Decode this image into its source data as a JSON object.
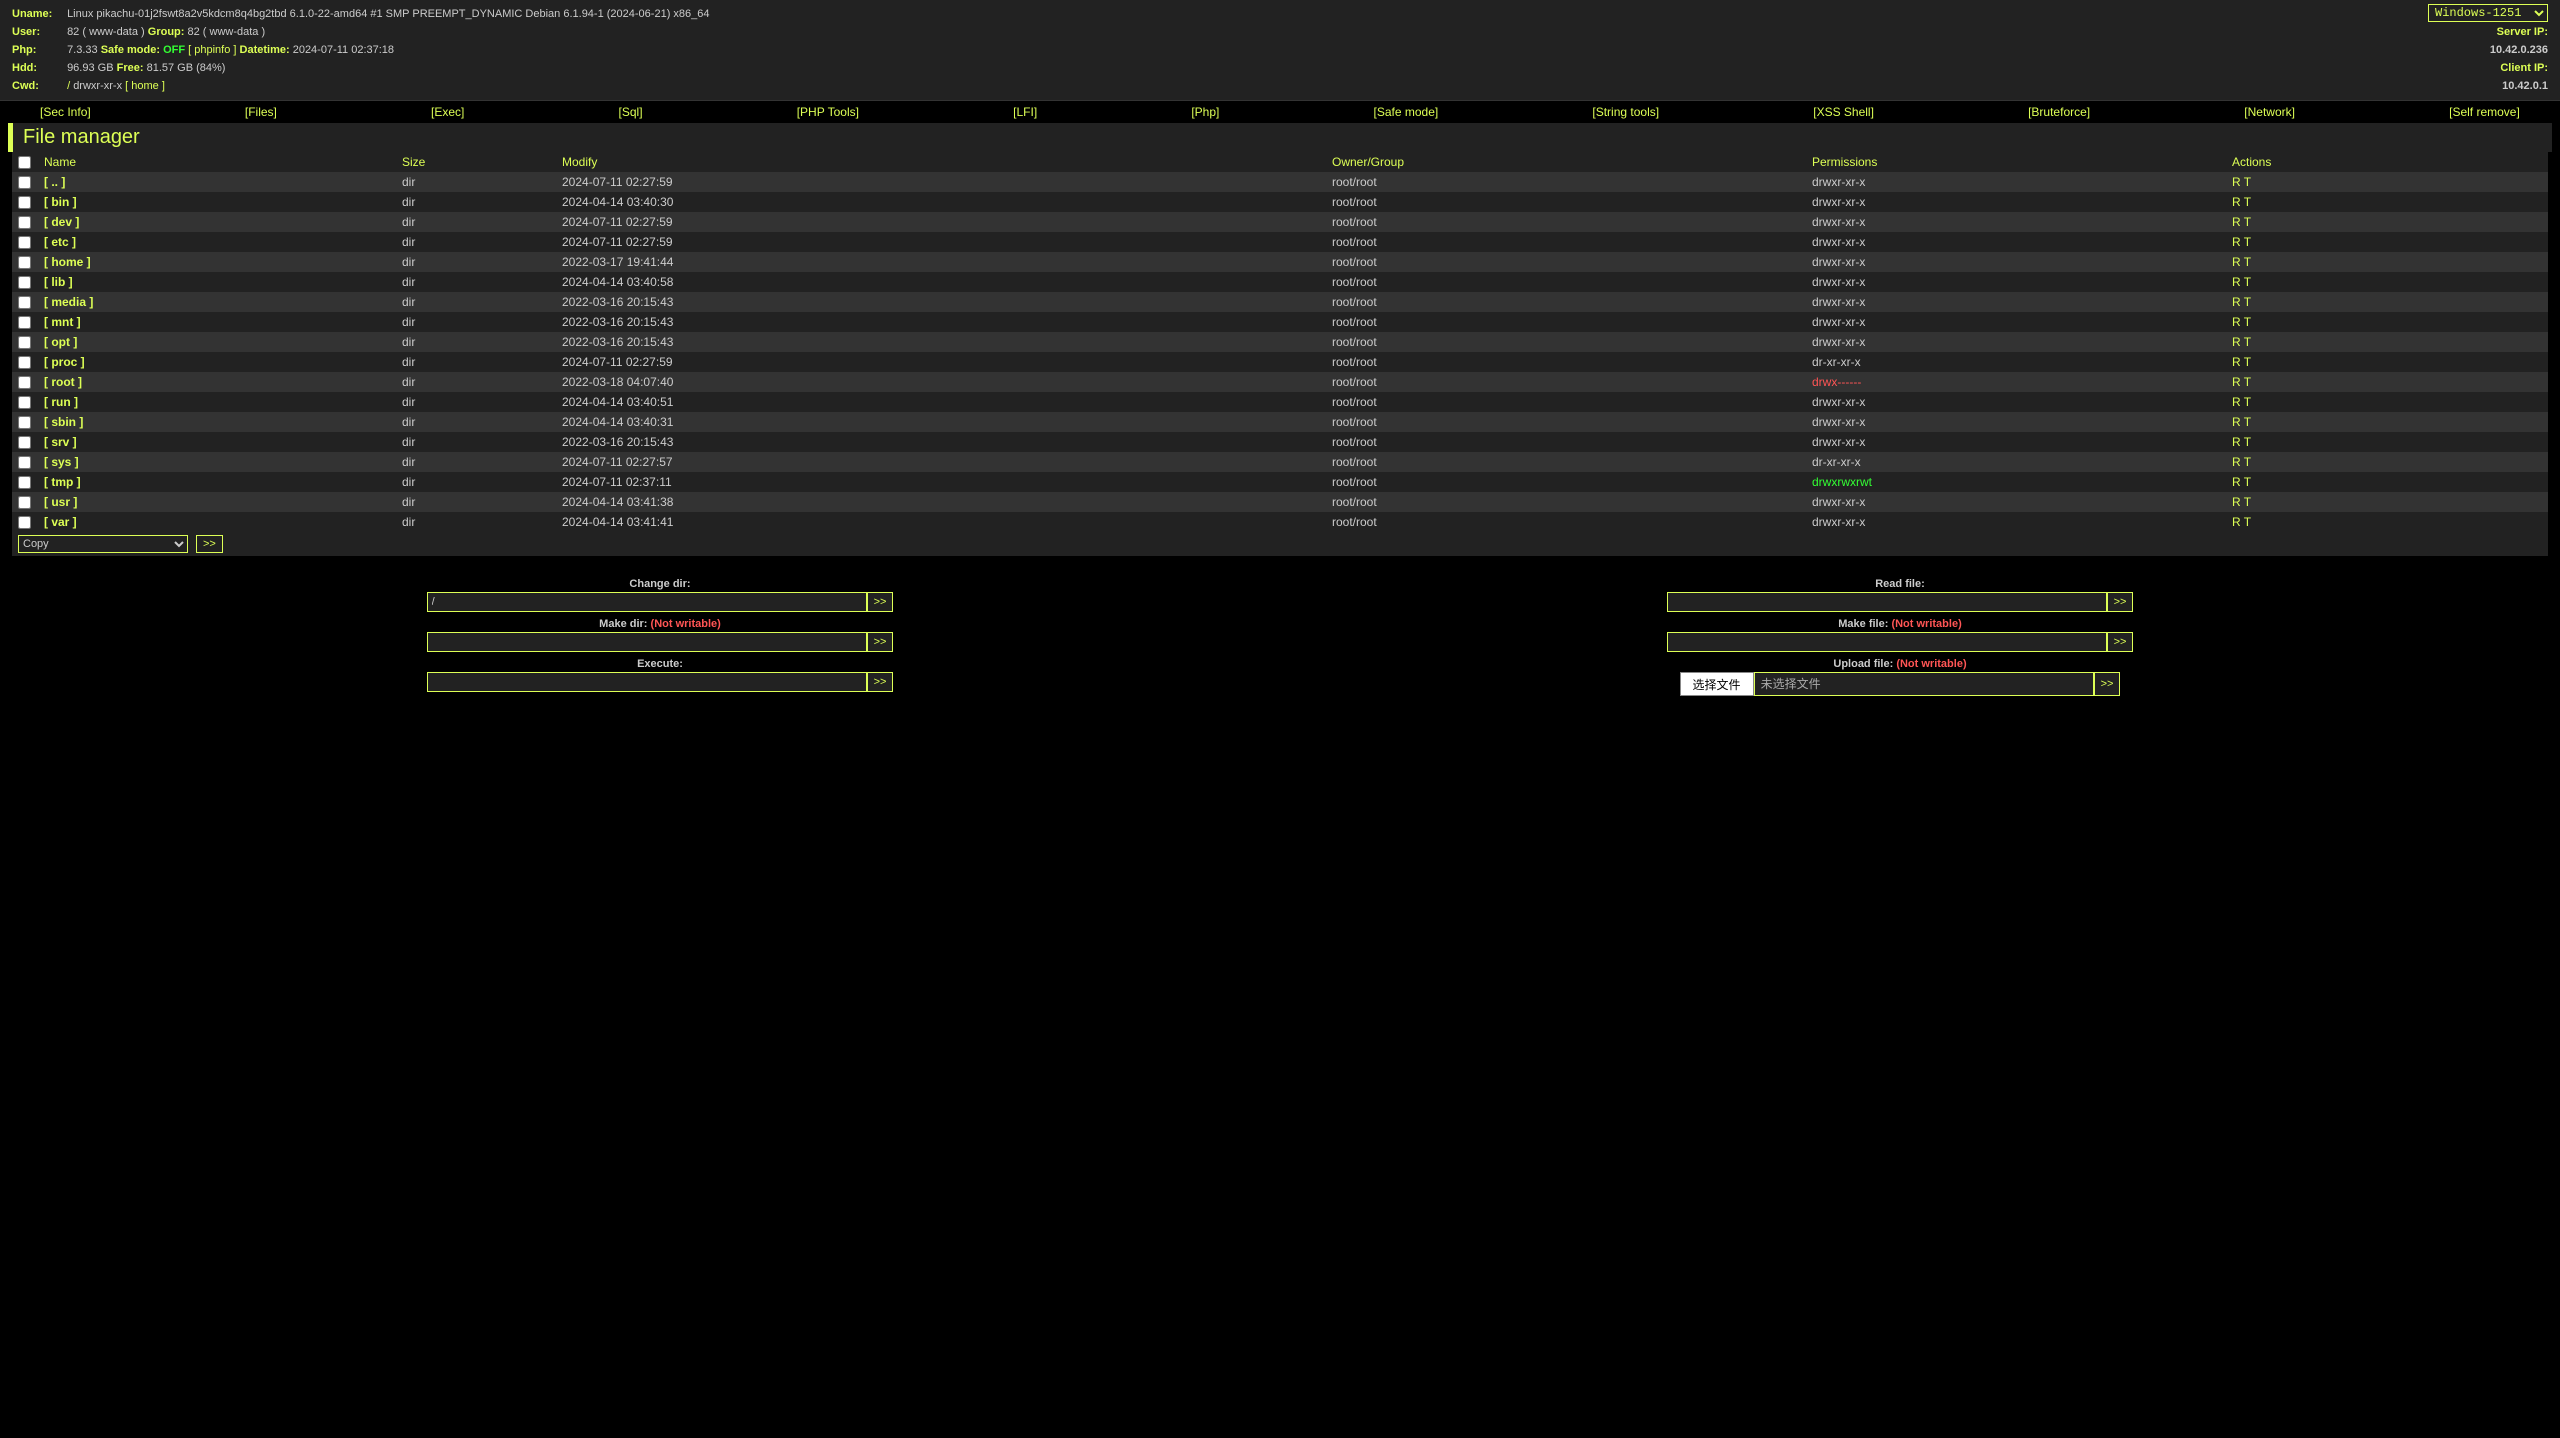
{
  "header": {
    "labels": {
      "uname": "Uname:",
      "user": "User:",
      "php": "Php:",
      "hdd": "Hdd:",
      "cwd": "Cwd:"
    },
    "uname": "Linux pikachu-01j2fswt8a2v5kdcm8q4bg2tbd 6.1.0-22-amd64 #1 SMP PREEMPT_DYNAMIC Debian 6.1.94-1 (2024-06-21) x86_64",
    "user_id": "82 ( www-data )",
    "group_label": "Group:",
    "group_id": "82 ( www-data )",
    "php_version": "7.3.33 ",
    "safe_mode_label": "Safe mode:",
    "safe_mode_value": "OFF",
    "phpinfo_link": "[ phpinfo ]",
    "datetime_label": "Datetime:",
    "datetime_value": "2024-07-11 02:37:18",
    "hdd_total": "96.93 GB ",
    "hdd_free_label": "Free:",
    "hdd_free": "81.57 GB (84%)",
    "cwd_path": "/ ",
    "cwd_perm": "drwxr-xr-x",
    "cwd_home": "[ home ]",
    "encoding": "Windows-1251",
    "server_ip_label": "Server IP:",
    "server_ip": "10.42.0.236",
    "client_ip_label": "Client IP:",
    "client_ip": "10.42.0.1"
  },
  "nav": [
    "[Sec Info]",
    "[Files]",
    "[Exec]",
    "[Sql]",
    "[PHP Tools]",
    "[LFI]",
    "[Php]",
    "[Safe mode]",
    "[String tools]",
    "[XSS Shell]",
    "[Bruteforce]",
    "[Network]",
    "[Self remove]"
  ],
  "panel_title": "File manager",
  "columns": {
    "name": "Name",
    "size": "Size",
    "modify": "Modify",
    "owner": "Owner/Group",
    "perms": "Permissions",
    "actions": "Actions"
  },
  "files": [
    {
      "name": "[ .. ]",
      "size": "dir",
      "modify": "2024-07-11 02:27:59",
      "owner": "root/root",
      "perms": "drwxr-xr-x",
      "pclass": "perm",
      "r": "R",
      "t": "T"
    },
    {
      "name": "[ bin ]",
      "size": "dir",
      "modify": "2024-04-14 03:40:30",
      "owner": "root/root",
      "perms": "drwxr-xr-x",
      "pclass": "perm",
      "r": "R",
      "t": "T"
    },
    {
      "name": "[ dev ]",
      "size": "dir",
      "modify": "2024-07-11 02:27:59",
      "owner": "root/root",
      "perms": "drwxr-xr-x",
      "pclass": "perm",
      "r": "R",
      "t": "T"
    },
    {
      "name": "[ etc ]",
      "size": "dir",
      "modify": "2024-07-11 02:27:59",
      "owner": "root/root",
      "perms": "drwxr-xr-x",
      "pclass": "perm",
      "r": "R",
      "t": "T"
    },
    {
      "name": "[ home ]",
      "size": "dir",
      "modify": "2022-03-17 19:41:44",
      "owner": "root/root",
      "perms": "drwxr-xr-x",
      "pclass": "perm",
      "r": "R",
      "t": "T"
    },
    {
      "name": "[ lib ]",
      "size": "dir",
      "modify": "2024-04-14 03:40:58",
      "owner": "root/root",
      "perms": "drwxr-xr-x",
      "pclass": "perm",
      "r": "R",
      "t": "T"
    },
    {
      "name": "[ media ]",
      "size": "dir",
      "modify": "2022-03-16 20:15:43",
      "owner": "root/root",
      "perms": "drwxr-xr-x",
      "pclass": "perm",
      "r": "R",
      "t": "T"
    },
    {
      "name": "[ mnt ]",
      "size": "dir",
      "modify": "2022-03-16 20:15:43",
      "owner": "root/root",
      "perms": "drwxr-xr-x",
      "pclass": "perm",
      "r": "R",
      "t": "T"
    },
    {
      "name": "[ opt ]",
      "size": "dir",
      "modify": "2022-03-16 20:15:43",
      "owner": "root/root",
      "perms": "drwxr-xr-x",
      "pclass": "perm",
      "r": "R",
      "t": "T"
    },
    {
      "name": "[ proc ]",
      "size": "dir",
      "modify": "2024-07-11 02:27:59",
      "owner": "root/root",
      "perms": "dr-xr-xr-x",
      "pclass": "perm",
      "r": "R",
      "t": "T"
    },
    {
      "name": "[ root ]",
      "size": "dir",
      "modify": "2022-03-18 04:07:40",
      "owner": "root/root",
      "perms": "drwx------",
      "pclass": "perm-red",
      "r": "R",
      "t": "T"
    },
    {
      "name": "[ run ]",
      "size": "dir",
      "modify": "2024-04-14 03:40:51",
      "owner": "root/root",
      "perms": "drwxr-xr-x",
      "pclass": "perm",
      "r": "R",
      "t": "T"
    },
    {
      "name": "[ sbin ]",
      "size": "dir",
      "modify": "2024-04-14 03:40:31",
      "owner": "root/root",
      "perms": "drwxr-xr-x",
      "pclass": "perm",
      "r": "R",
      "t": "T"
    },
    {
      "name": "[ srv ]",
      "size": "dir",
      "modify": "2022-03-16 20:15:43",
      "owner": "root/root",
      "perms": "drwxr-xr-x",
      "pclass": "perm",
      "r": "R",
      "t": "T"
    },
    {
      "name": "[ sys ]",
      "size": "dir",
      "modify": "2024-07-11 02:27:57",
      "owner": "root/root",
      "perms": "dr-xr-xr-x",
      "pclass": "perm",
      "r": "R",
      "t": "T"
    },
    {
      "name": "[ tmp ]",
      "size": "dir",
      "modify": "2024-07-11 02:37:11",
      "owner": "root/root",
      "perms": "drwxrwxrwt",
      "pclass": "perm-green",
      "r": "R",
      "t": "T"
    },
    {
      "name": "[ usr ]",
      "size": "dir",
      "modify": "2024-04-14 03:41:38",
      "owner": "root/root",
      "perms": "drwxr-xr-x",
      "pclass": "perm",
      "r": "R",
      "t": "T"
    },
    {
      "name": "[ var ]",
      "size": "dir",
      "modify": "2024-04-14 03:41:41",
      "owner": "root/root",
      "perms": "drwxr-xr-x",
      "pclass": "perm",
      "r": "R",
      "t": "T"
    }
  ],
  "batch_action": "Copy",
  "go_button": ">>",
  "forms": {
    "change_dir": {
      "label": "Change dir:",
      "value": "/"
    },
    "make_dir": {
      "label": "Make dir:",
      "nw": "(Not writable)",
      "value": ""
    },
    "execute": {
      "label": "Execute:",
      "value": ""
    },
    "read_file": {
      "label": "Read file:",
      "value": ""
    },
    "make_file": {
      "label": "Make file:",
      "nw": "(Not writable)",
      "value": ""
    },
    "upload_file": {
      "label": "Upload file:",
      "nw": "(Not writable)",
      "choose": "选择文件",
      "none": "未选择文件"
    }
  }
}
